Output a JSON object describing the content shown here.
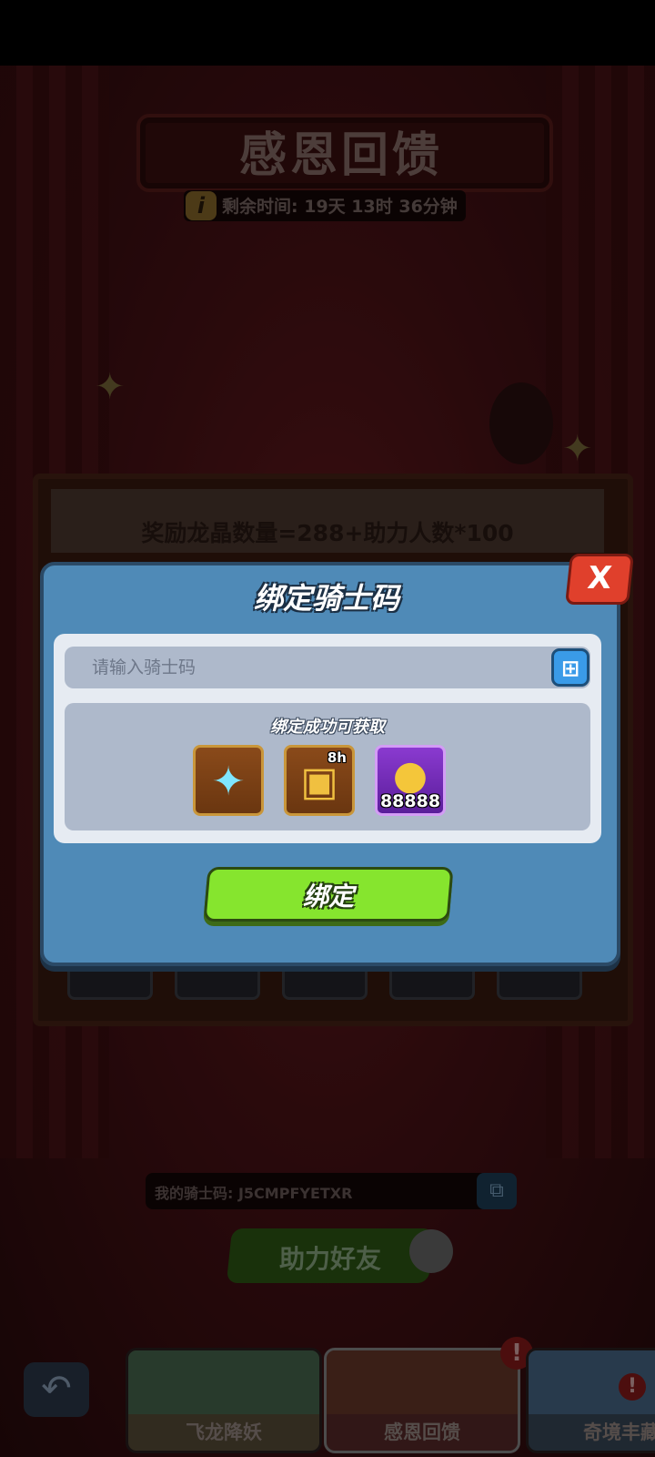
{
  "event": {
    "title": "感恩回馈",
    "timer_label": "剩余时间:",
    "timer_value": "19天 13时 36分钟",
    "info_icon": "info-icon",
    "formula": "奖励龙晶数量=288+助力人数*100"
  },
  "modal": {
    "title": "绑定骑士码",
    "close_label": "X",
    "input_placeholder": "请输入骑士码",
    "input_value": "",
    "paste_icon": "add-paste-icon",
    "rewards_label": "绑定成功可获取",
    "rewards": [
      {
        "icon": "crystal-icon",
        "badge": "",
        "count": ""
      },
      {
        "icon": "treasure-chest-icon",
        "badge": "8h",
        "count": ""
      },
      {
        "icon": "gold-coins-icon",
        "badge": "",
        "count": "88888"
      }
    ],
    "bind_label": "绑定"
  },
  "footer": {
    "my_code_label": "我的骑士码: J5CMPFYETXR",
    "copy_icon": "copy-icon",
    "help_button_label": "助力好友",
    "back_icon": "back-arrow-icon"
  },
  "tabs": [
    {
      "label": "飞龙降妖",
      "selected": false,
      "alert": false
    },
    {
      "label": "感恩回馈",
      "selected": true,
      "alert": true
    },
    {
      "label": "奇境丰藏",
      "selected": false,
      "alert": true
    }
  ],
  "colors": {
    "modal_blue": "#4f8ab7",
    "bind_green": "#86e52e",
    "close_red": "#e0402c",
    "panel_gray": "#aeb9cb"
  }
}
